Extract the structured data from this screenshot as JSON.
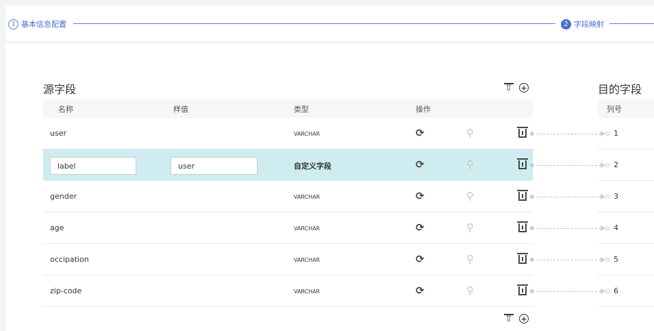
{
  "steps": [
    {
      "num": "1",
      "label": "基本信息配置"
    },
    {
      "num": "2",
      "label": "字段映射"
    }
  ],
  "source_title": "源字段",
  "target_title": "目的字段",
  "source_headers": {
    "name": "名称",
    "sample": "样值",
    "type": "类型",
    "ops": "操作"
  },
  "target_headers": {
    "col": "列号"
  },
  "rows": [
    {
      "name": "user",
      "sample": "",
      "type": "VARCHAR",
      "col": "1"
    },
    {
      "name": "label",
      "sample": "user",
      "type": "自定义字段",
      "col": "2",
      "editable": true
    },
    {
      "name": "gender",
      "sample": "",
      "type": "VARCHAR",
      "col": "3"
    },
    {
      "name": "age",
      "sample": "",
      "type": "VARCHAR",
      "col": "4"
    },
    {
      "name": "occipation",
      "sample": "",
      "type": "VARCHAR",
      "col": "5"
    },
    {
      "name": "zip-code",
      "sample": "",
      "type": "VARCHAR",
      "col": "6"
    }
  ],
  "icons": {
    "sync": "sync-icon",
    "search": "search-icon",
    "delete": "trash-icon",
    "move_top": "move-top-icon",
    "add": "add-circle-icon"
  },
  "colors": {
    "accent": "#4a6fd1",
    "highlight_row": "#cfecf0"
  }
}
